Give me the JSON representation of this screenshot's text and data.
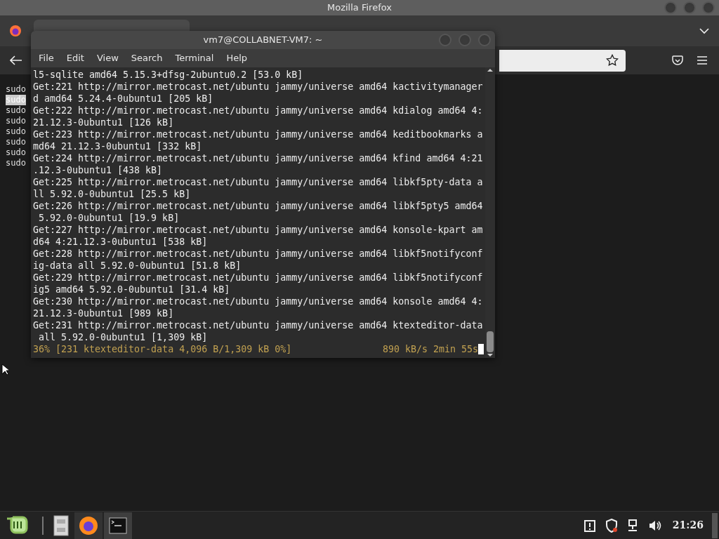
{
  "desktop_window": {
    "title": "Mozilla Firefox"
  },
  "browser_lines": [
    {
      "text": "sudo",
      "selected": false
    },
    {
      "text": "sudo",
      "selected": true
    },
    {
      "text": "sudo",
      "selected": false
    },
    {
      "text": "sudo",
      "selected": false
    },
    {
      "text": "sudo",
      "selected": false
    },
    {
      "text": "sudo",
      "selected": false
    },
    {
      "text": "sudo",
      "selected": false
    },
    {
      "text": "sudo",
      "selected": false
    }
  ],
  "terminal": {
    "title": "vm7@COLLABNET-VM7: ~",
    "menu": [
      "File",
      "Edit",
      "View",
      "Search",
      "Terminal",
      "Help"
    ],
    "lines": [
      "l5-sqlite amd64 5.15.3+dfsg-2ubuntu0.2 [53.0 kB]",
      "Get:221 http://mirror.metrocast.net/ubuntu jammy/universe amd64 kactivitymanager",
      "d amd64 5.24.4-0ubuntu1 [205 kB]",
      "Get:222 http://mirror.metrocast.net/ubuntu jammy/universe amd64 kdialog amd64 4:",
      "21.12.3-0ubuntu1 [126 kB]",
      "Get:223 http://mirror.metrocast.net/ubuntu jammy/universe amd64 keditbookmarks a",
      "md64 21.12.3-0ubuntu1 [332 kB]",
      "Get:224 http://mirror.metrocast.net/ubuntu jammy/universe amd64 kfind amd64 4:21",
      ".12.3-0ubuntu1 [438 kB]",
      "Get:225 http://mirror.metrocast.net/ubuntu jammy/universe amd64 libkf5pty-data a",
      "ll 5.92.0-0ubuntu1 [25.5 kB]",
      "Get:226 http://mirror.metrocast.net/ubuntu jammy/universe amd64 libkf5pty5 amd64",
      " 5.92.0-0ubuntu1 [19.9 kB]",
      "Get:227 http://mirror.metrocast.net/ubuntu jammy/universe amd64 konsole-kpart am",
      "d64 4:21.12.3-0ubuntu1 [538 kB]",
      "Get:228 http://mirror.metrocast.net/ubuntu jammy/universe amd64 libkf5notifyconf",
      "ig-data all 5.92.0-0ubuntu1 [51.8 kB]",
      "Get:229 http://mirror.metrocast.net/ubuntu jammy/universe amd64 libkf5notifyconf",
      "ig5 amd64 5.92.0-0ubuntu1 [31.4 kB]",
      "Get:230 http://mirror.metrocast.net/ubuntu jammy/universe amd64 konsole amd64 4:",
      "21.12.3-0ubuntu1 [989 kB]",
      "Get:231 http://mirror.metrocast.net/ubuntu jammy/universe amd64 ktexteditor-data",
      " all 5.92.0-0ubuntu1 [1,309 kB]"
    ],
    "status_left": "36% [231 ktexteditor-data 4,096 B/1,309 kB 0%]",
    "status_right": "890 kB/s 2min 55s"
  },
  "taskbar": {
    "clock": "21:26"
  }
}
